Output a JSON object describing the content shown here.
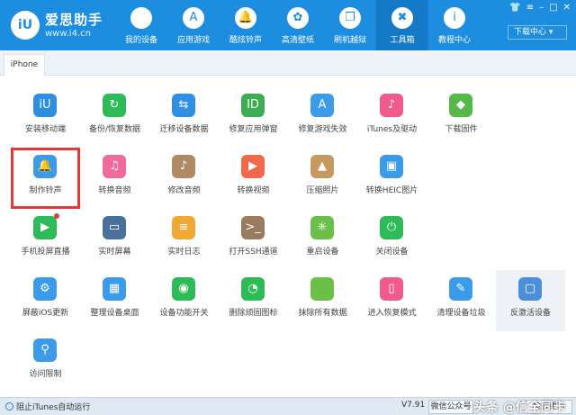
{
  "brand": {
    "logo": "iU",
    "name": "爱思助手",
    "url": "www.i4.cn"
  },
  "window_controls": [
    "👕",
    "≡",
    "–",
    "□",
    "✕"
  ],
  "download_center": "下载中心 ▾",
  "nav": [
    {
      "label": "我的设备",
      "icon": "apple-icon",
      "glyph": ""
    },
    {
      "label": "应用游戏",
      "icon": "app-store-icon",
      "glyph": "A"
    },
    {
      "label": "酷炫铃声",
      "icon": "bell-icon",
      "glyph": "🔔"
    },
    {
      "label": "高清壁纸",
      "icon": "flower-icon",
      "glyph": "✿"
    },
    {
      "label": "刷机越狱",
      "icon": "box-icon",
      "glyph": "❒"
    },
    {
      "label": "工具箱",
      "icon": "tools-icon",
      "glyph": "✖"
    },
    {
      "label": "教程中心",
      "icon": "info-icon",
      "glyph": "i"
    }
  ],
  "active_nav": "工具箱",
  "tab": "iPhone",
  "tools": [
    {
      "label": "安装移动端",
      "icon": "i4-app-icon",
      "glyph": "iU",
      "color": "#2e8fe0"
    },
    {
      "label": "备份/恢复数据",
      "icon": "backup-icon",
      "glyph": "↻",
      "color": "#2dbb57"
    },
    {
      "label": "迁移设备数据",
      "icon": "phone-transfer-icon",
      "glyph": "⇆",
      "color": "#2f8fe4"
    },
    {
      "label": "修复应用弹窗",
      "icon": "apple-id-icon",
      "glyph": "ID",
      "color": "#3cad52"
    },
    {
      "label": "修复游戏失效",
      "icon": "app-store-icon",
      "glyph": "A",
      "color": "#3b9be8"
    },
    {
      "label": "iTunes及驱动",
      "icon": "music-note-icon",
      "glyph": "♪",
      "color": "#ef5b8a"
    },
    {
      "label": "下载固件",
      "icon": "cube-icon",
      "glyph": "◆",
      "color": "#54b948"
    },
    {
      "label": "",
      "icon": "",
      "glyph": "",
      "color": ""
    },
    {
      "label": "制作铃声",
      "icon": "bell-icon",
      "glyph": "🔔",
      "color": "#3b9be8"
    },
    {
      "label": "转换音频",
      "icon": "music-icon",
      "glyph": "♫",
      "color": "#f06a9b"
    },
    {
      "label": "修改音频",
      "icon": "audio-edit-icon",
      "glyph": "♪",
      "color": "#b08a62"
    },
    {
      "label": "转换视频",
      "icon": "play-icon",
      "glyph": "▶",
      "color": "#ef6a4a"
    },
    {
      "label": "压缩照片",
      "icon": "photo-icon",
      "glyph": "▲",
      "color": "#c7985f"
    },
    {
      "label": "转换HEIC图片",
      "icon": "image-convert-icon",
      "glyph": "▣",
      "color": "#3b9be8"
    },
    {
      "label": "",
      "icon": "",
      "glyph": "",
      "color": ""
    },
    {
      "label": "",
      "icon": "",
      "glyph": "",
      "color": ""
    },
    {
      "label": "手机投屏直播",
      "icon": "screen-mirror-icon",
      "glyph": "▶",
      "color": "#2dbb57"
    },
    {
      "label": "实时屏幕",
      "icon": "monitor-icon",
      "glyph": "▭",
      "color": "#4a6f99"
    },
    {
      "label": "实时日志",
      "icon": "log-icon",
      "glyph": "≡",
      "color": "#f0a832"
    },
    {
      "label": "打开SSH通道",
      "icon": "terminal-icon",
      "glyph": ">_",
      "color": "#9a7b5e"
    },
    {
      "label": "重启设备",
      "icon": "restart-icon",
      "glyph": "✳",
      "color": "#6cc04a"
    },
    {
      "label": "关闭设备",
      "icon": "power-icon",
      "glyph": "⏻",
      "color": "#2dbb57"
    },
    {
      "label": "",
      "icon": "",
      "glyph": "",
      "color": ""
    },
    {
      "label": "",
      "icon": "",
      "glyph": "",
      "color": ""
    },
    {
      "label": "屏蔽iOS更新",
      "icon": "gear-icon",
      "glyph": "⚙",
      "color": "#3b9be8"
    },
    {
      "label": "整理设备桌面",
      "icon": "grid-icon",
      "glyph": "▦",
      "color": "#3b9be8"
    },
    {
      "label": "设备功能开关",
      "icon": "toggle-icon",
      "glyph": "◉",
      "color": "#2dbb57"
    },
    {
      "label": "删除顽固图标",
      "icon": "pie-icon",
      "glyph": "◔",
      "color": "#2dbb57"
    },
    {
      "label": "抹除所有数据",
      "icon": "apple-icon",
      "glyph": "",
      "color": "#6cc04a"
    },
    {
      "label": "进入恢复模式",
      "icon": "recovery-icon",
      "glyph": "▯",
      "color": "#ef5b8a"
    },
    {
      "label": "清理设备垃圾",
      "icon": "broom-icon",
      "glyph": "✎",
      "color": "#3b9be8"
    },
    {
      "label": "反激活设备",
      "icon": "deactivate-icon",
      "glyph": "▢",
      "color": "#4a8fd8"
    },
    {
      "label": "访问限制",
      "icon": "lock-icon",
      "glyph": "⚲",
      "color": "#3b9be8"
    }
  ],
  "selected_tool": "制作铃声",
  "hover_tool": "反激活设备",
  "badge_tool": "手机投屏直播",
  "status": {
    "itunes_block": "阻止iTunes自动运行",
    "version": "V7.91",
    "wechat": "微信公众号",
    "check_update": "检查更新",
    "watermark": "头条 @信全同卡"
  }
}
